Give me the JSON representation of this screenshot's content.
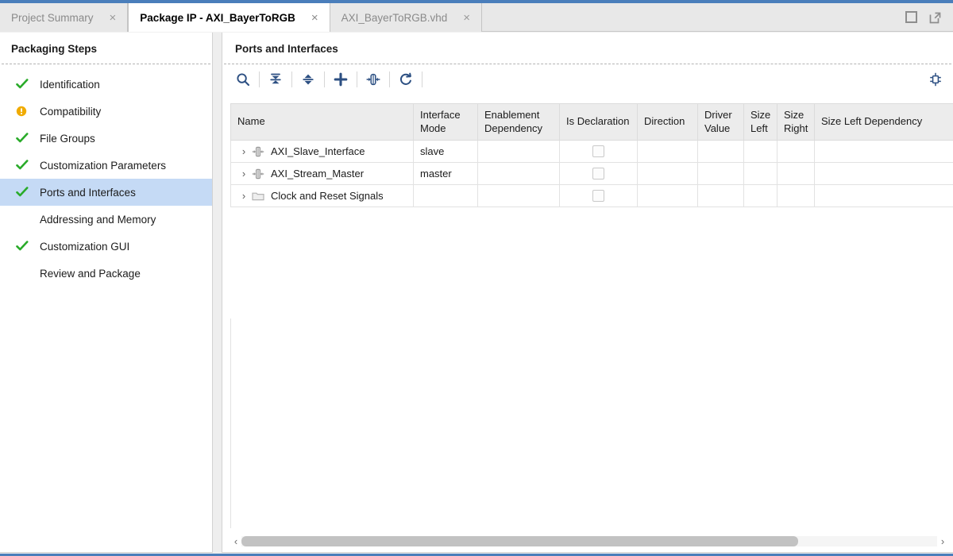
{
  "window": {
    "maximize_icon": "maximize-icon",
    "float_icon": "float-window-icon"
  },
  "tabs": [
    {
      "label": "Project Summary",
      "active": false,
      "close": "×"
    },
    {
      "label": "Package IP - AXI_BayerToRGB",
      "active": true,
      "close": "×"
    },
    {
      "label": "AXI_BayerToRGB.vhd",
      "active": false,
      "close": "×"
    }
  ],
  "sidebar": {
    "title": "Packaging Steps",
    "items": [
      {
        "label": "Identification",
        "status": "check",
        "selected": false
      },
      {
        "label": "Compatibility",
        "status": "warning",
        "selected": false
      },
      {
        "label": "File Groups",
        "status": "check",
        "selected": false
      },
      {
        "label": "Customization Parameters",
        "status": "check",
        "selected": false
      },
      {
        "label": "Ports and Interfaces",
        "status": "check",
        "selected": true
      },
      {
        "label": "Addressing and Memory",
        "status": "none",
        "selected": false
      },
      {
        "label": "Customization GUI",
        "status": "check",
        "selected": false
      },
      {
        "label": "Review and Package",
        "status": "none",
        "selected": false
      }
    ]
  },
  "main": {
    "title": "Ports and Interfaces",
    "toolbar": [
      {
        "name": "search-icon",
        "tooltip": "Search"
      },
      {
        "name": "collapse-all-icon",
        "tooltip": "Collapse All"
      },
      {
        "name": "expand-all-icon",
        "tooltip": "Expand All"
      },
      {
        "name": "add-icon",
        "tooltip": "Add"
      },
      {
        "name": "bus-interface-icon",
        "tooltip": "Auto Infer Interface"
      },
      {
        "name": "refresh-icon",
        "tooltip": "Refresh"
      }
    ],
    "toolbar_right": {
      "name": "ip-settings-icon",
      "tooltip": "Settings"
    },
    "table": {
      "columns": [
        "Name",
        "Interface Mode",
        "Enablement Dependency",
        "Is Declaration",
        "Direction",
        "Driver Value",
        "Size Left",
        "Size Right",
        "Size Left Dependency"
      ],
      "rows": [
        {
          "twisty": "›",
          "icon": "bus-interface-icon",
          "name": "AXI_Slave_Interface",
          "interface_mode": "slave",
          "enablement_dependency": "",
          "is_declaration": false,
          "direction": "",
          "driver_value": "",
          "size_left": "",
          "size_right": "",
          "size_left_dependency": ""
        },
        {
          "twisty": "›",
          "icon": "bus-interface-icon",
          "name": "AXI_Stream_Master",
          "interface_mode": "master",
          "enablement_dependency": "",
          "is_declaration": false,
          "direction": "",
          "driver_value": "",
          "size_left": "",
          "size_right": "",
          "size_left_dependency": ""
        },
        {
          "twisty": "›",
          "icon": "folder-icon",
          "name": "Clock and Reset Signals",
          "interface_mode": "",
          "enablement_dependency": "",
          "is_declaration": false,
          "direction": "",
          "driver_value": "",
          "size_left": "",
          "size_right": "",
          "size_left_dependency": ""
        }
      ]
    },
    "scrollbar": {
      "left_arrow": "‹",
      "right_arrow": "›",
      "thumb_percent": 80
    }
  },
  "colors": {
    "accent_blue": "#4a7ebb",
    "selection_blue": "#c5daf5",
    "check_green": "#2aab2a",
    "warn_orange": "#f0ab00",
    "icon_blue": "#2c4f82",
    "row_icon_gray": "#9a9a9a"
  }
}
